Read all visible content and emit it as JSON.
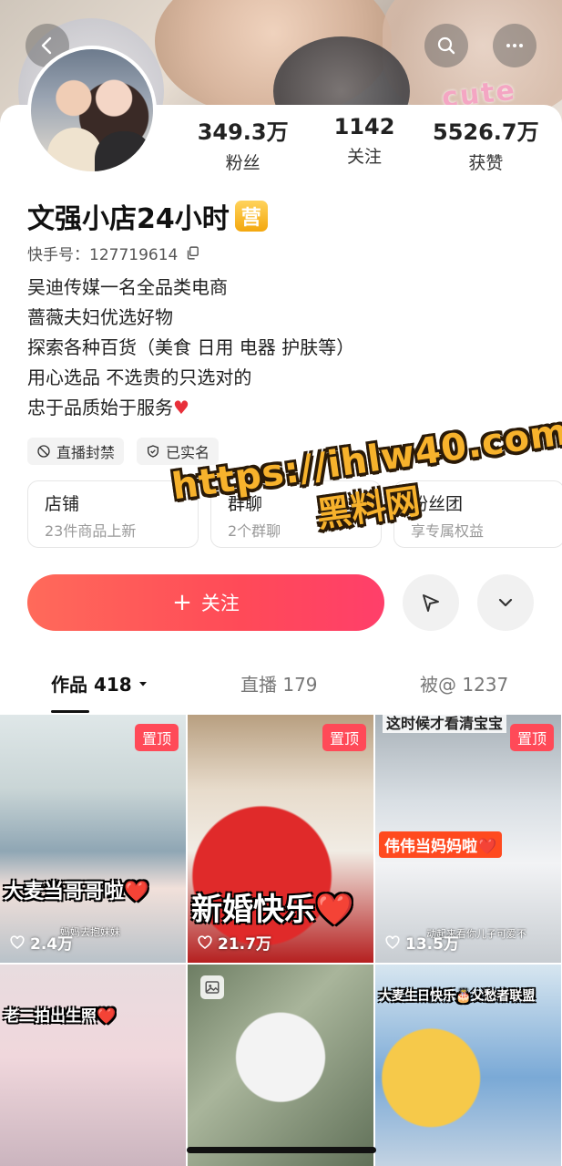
{
  "header": {
    "banner_text": "cute",
    "icons": [
      "back-icon",
      "search-icon",
      "more-icon"
    ]
  },
  "profile": {
    "stats": [
      {
        "value": "349.3万",
        "label": "粉丝"
      },
      {
        "value": "1142",
        "label": "关注"
      },
      {
        "value": "5526.7万",
        "label": "获赞"
      }
    ],
    "name": "文强小店24小时",
    "badge": "营",
    "kuaishou_id": "快手号：127719614",
    "bio": [
      "吴迪传媒一名全品类电商",
      "蔷薇夫妇优选好物",
      "探索各种百货（美食 日用 电器 护肤等）",
      "用心选品 不选贵的只选对的",
      "忠于品质始于服务"
    ],
    "bio_heart": "♥",
    "tags": [
      "直播封禁",
      "已实名"
    ]
  },
  "shortcuts": [
    {
      "title": "店铺",
      "subtitle": "23件商品上新"
    },
    {
      "title": "群聊",
      "subtitle": "2个群聊"
    },
    {
      "title": "粉丝团",
      "subtitle": "享专属权益"
    }
  ],
  "actions": {
    "follow_label": "关注",
    "follow_plus": "+"
  },
  "tabs": [
    {
      "label": "作品 418",
      "active": true
    },
    {
      "label": "直播 179",
      "active": false
    },
    {
      "label": "被@ 1237",
      "active": false
    }
  ],
  "videos": [
    {
      "pinned": "置顶",
      "caption": "大麦当哥哥啦❤️",
      "sub": "妈妈去抱妹妹",
      "likes": "2.4万"
    },
    {
      "pinned": "置顶",
      "caption": "新婚快乐❤️",
      "likes": "21.7万"
    },
    {
      "pinned": "置顶",
      "topline": "这时候才看清宝宝",
      "caption": "伟伟当妈妈啦❤️",
      "sub": "动起来看你儿子可爱不",
      "likes": "13.5万"
    },
    {
      "caption": "老二拍出生照❤️"
    },
    {
      "caption": ""
    },
    {
      "caption": "大麦生日快乐🎂父愁者联盟"
    }
  ],
  "watermark": {
    "url": "https://ihlw40.com",
    "name": "黑料网"
  },
  "colors": {
    "accent": "#ff4a58",
    "badge": "#f3a70e",
    "watermark": "#f7b22c"
  }
}
